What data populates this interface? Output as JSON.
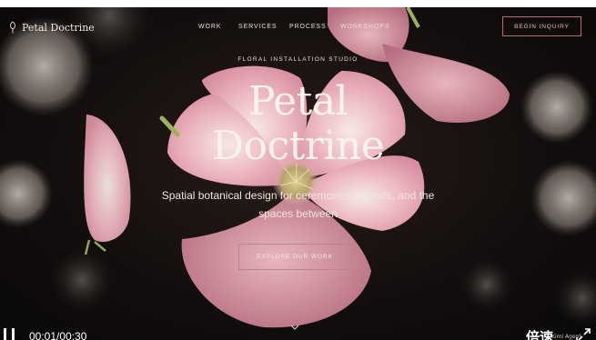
{
  "brand": {
    "name": "Petal Doctrine"
  },
  "nav": {
    "links": [
      "WORK",
      "SERVICES",
      "PROCESS",
      "WORKSHOPS"
    ],
    "cta": "BEGIN INQUIRY"
  },
  "hero": {
    "eyebrow": "FLORAL INSTALLATION STUDIO",
    "title_line1": "Petal",
    "title_line2": "Doctrine",
    "subtitle": "Spatial botanical design for ceremonies, brands, and the spaces between",
    "cta": "EXPLORE OUR WORK"
  },
  "player": {
    "time": "00:01/00:30",
    "speed_label": "倍速",
    "watermark": "Kimi Agent"
  },
  "colors": {
    "accent": "#b96a6e",
    "petal": "#e9a6b4",
    "background": "#140f0e"
  }
}
